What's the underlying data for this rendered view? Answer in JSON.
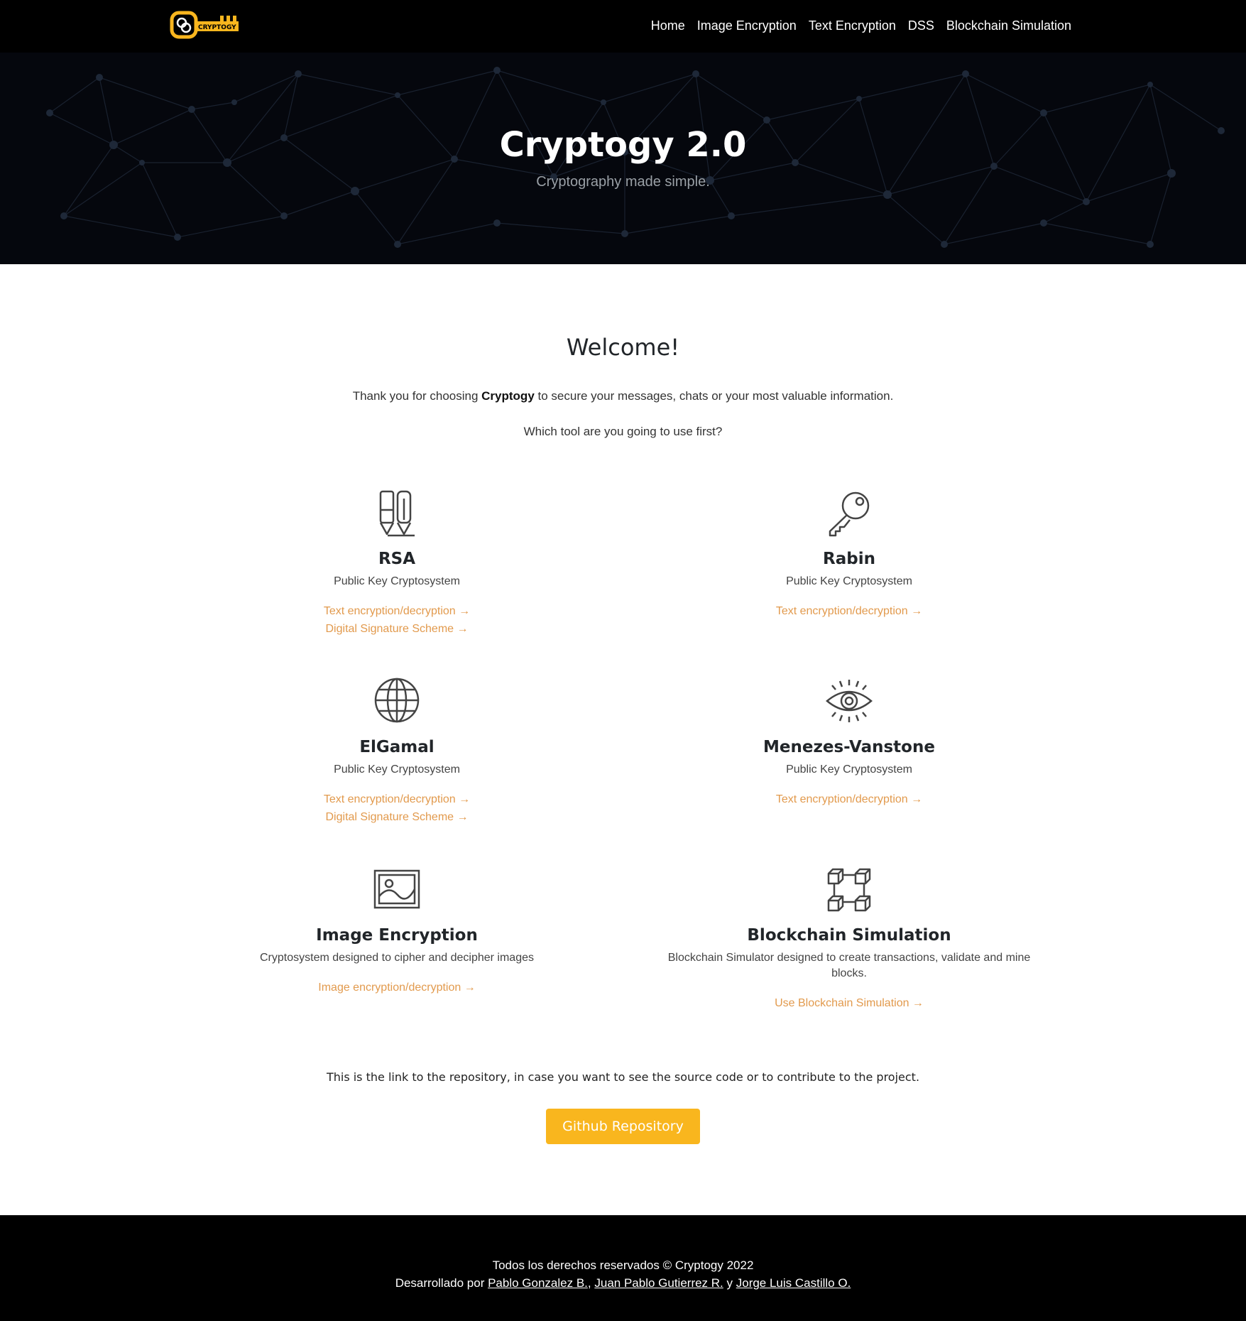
{
  "header": {
    "logo_text": "CRYPTOGY",
    "nav": [
      "Home",
      "Image Encryption",
      "Text Encryption",
      "DSS",
      "Blockchain Simulation"
    ]
  },
  "hero": {
    "title": "Cryptogy 2.0",
    "subtitle": "Cryptography made simple."
  },
  "main": {
    "welcome": "Welcome!",
    "intro_before": "Thank you for choosing ",
    "intro_brand": "Cryptogy",
    "intro_after": " to secure your messages, chats or your most valuable information.",
    "question": "Which tool are you going to use first?",
    "cards": [
      {
        "icon": "pens-icon",
        "title": "RSA",
        "desc": "Public Key Cryptosystem",
        "links": [
          "Text encryption/decryption →",
          "Digital Signature Scheme →"
        ]
      },
      {
        "icon": "key-icon",
        "title": "Rabin",
        "desc": "Public Key Cryptosystem",
        "links": [
          "Text encryption/decryption →"
        ]
      },
      {
        "icon": "globe-icon",
        "title": "ElGamal",
        "desc": "Public Key Cryptosystem",
        "links": [
          "Text encryption/decryption →",
          "Digital Signature Scheme →"
        ]
      },
      {
        "icon": "eye-icon",
        "title": "Menezes-Vanstone",
        "desc": "Public Key Cryptosystem",
        "links": [
          "Text encryption/decryption →"
        ]
      },
      {
        "icon": "image-icon",
        "title": "Image Encryption",
        "desc": "Cryptosystem designed to cipher and decipher images",
        "links": [
          "Image encryption/decryption →"
        ]
      },
      {
        "icon": "blocks-icon",
        "title": "Blockchain Simulation",
        "desc": "Blockchain Simulator designed to create transactions, validate and mine blocks.",
        "links": [
          "Use Blockchain Simulation →"
        ]
      }
    ],
    "repo_text": "This is the link to the repository, in case you want to see the source code or to contribute to the project.",
    "repo_button": "Github Repository"
  },
  "footer": {
    "rights": "Todos los derechos reservados © Cryptogy 2022",
    "dev_prefix": "Desarrollado por ",
    "authors": [
      "Pablo Gonzalez B.",
      "Juan Pablo Gutierrez R.",
      "Jorge Luis Castillo O."
    ],
    "sep1": ", ",
    "sep2": " y "
  },
  "colors": {
    "accent": "#f9b61e",
    "link": "#e29a4d",
    "dark": "#000000"
  }
}
